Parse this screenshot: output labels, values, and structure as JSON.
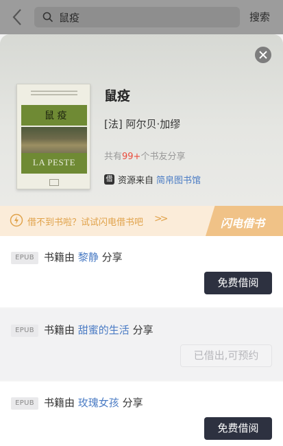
{
  "search": {
    "query": "鼠疫",
    "button": "搜索"
  },
  "book": {
    "title": "鼠疫",
    "author": "[法] 阿尔贝·加缪",
    "cover_title": "鼠 疫",
    "cover_latin": "LA PESTE",
    "share_prefix": "共有",
    "share_count": "99+",
    "share_suffix": "个书友分享",
    "source_badge": "借",
    "source_label": "资源来自",
    "source_name": "简帛图书馆"
  },
  "promo": {
    "text": "借不到书啦？试试闪电借书吧",
    "arrows": ">>",
    "brand": "闪电借书"
  },
  "rows": [
    {
      "format": "EPUB",
      "prefix": "书籍由",
      "name": "黎静",
      "suffix": "分享",
      "action": "免费借阅"
    },
    {
      "format": "EPUB",
      "prefix": "书籍由",
      "name": "甜蜜的生活",
      "suffix": "分享",
      "action": "已借出,可预约"
    },
    {
      "format": "EPUB",
      "prefix": "书籍由",
      "name": "玫瑰女孩",
      "suffix": "分享",
      "action": "免费借阅"
    }
  ],
  "colors": {
    "accent_blue": "#4a7bc4",
    "count_red": "#e94b3c",
    "promo_orange": "#e0a24a",
    "button_dark": "#2d3140"
  }
}
